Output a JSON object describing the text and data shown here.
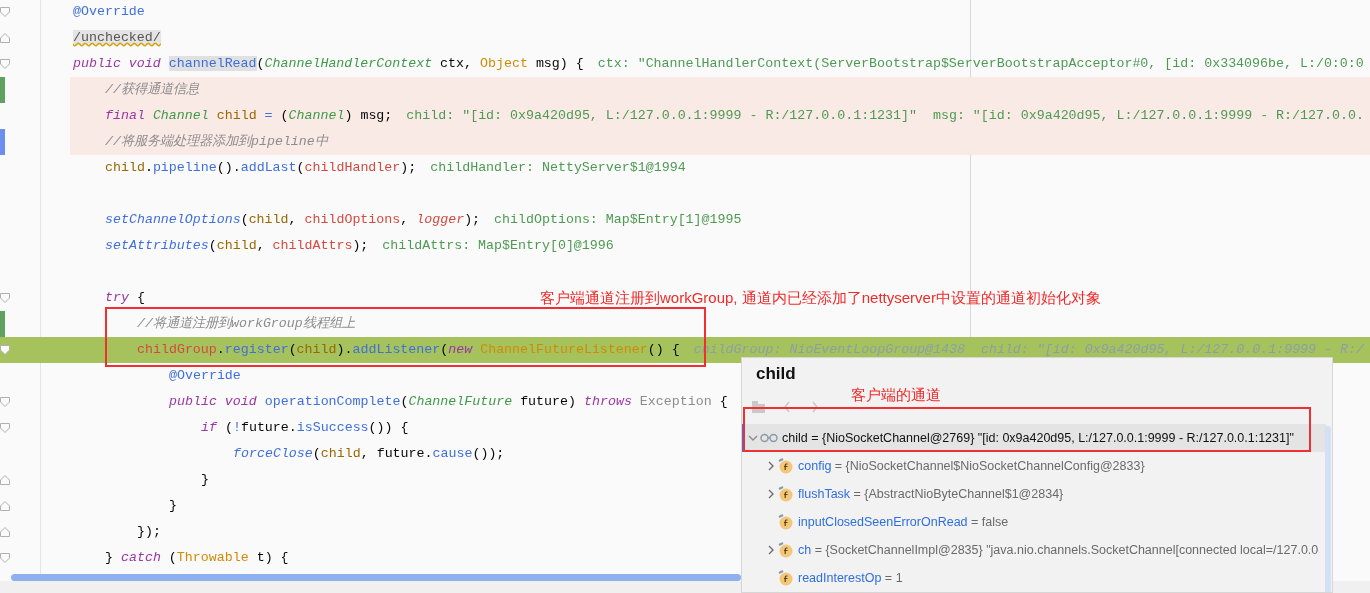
{
  "editor": {
    "lines": [
      {
        "kind": "code",
        "changed": false,
        "current": false,
        "added_mark": false,
        "modified_mark": false,
        "fold_start": true,
        "fold_end": false,
        "tokens": [
          {
            "text": "@Override",
            "kind": "annotation"
          }
        ]
      },
      {
        "kind": "code",
        "changed": false,
        "current": false,
        "added_mark": false,
        "modified_mark": false,
        "fold_start": false,
        "fold_end": true,
        "tokens": [
          {
            "text": "/unchecked/",
            "kind": "suppressed"
          }
        ]
      },
      {
        "kind": "code",
        "changed": false,
        "current": false,
        "added_mark": false,
        "modified_mark": false,
        "fold_start": true,
        "fold_end": false,
        "tokens": [
          {
            "text": "public",
            "kind": "keyword"
          },
          {
            "text": " void ",
            "kind": "keyword"
          },
          {
            "text": "channelRead",
            "kind": "selected"
          },
          {
            "text": "(",
            "kind": "plain"
          },
          {
            "text": "ChannelHandlerContext",
            "kind": "type"
          },
          {
            "text": " ctx, ",
            "kind": "plain"
          },
          {
            "text": "Object",
            "kind": "class"
          },
          {
            "text": " msg) {",
            "kind": "plain"
          }
        ],
        "hint": "ctx: \"ChannelHandlerContext(ServerBootstrap$ServerBootstrapAcceptor#0, [id: 0x334096be, L:/0:0:0",
        "children": [
          {
            "kind": "code",
            "changed": true,
            "current": false,
            "added_mark": true,
            "modified_mark": false,
            "fold_start": false,
            "fold_end": false,
            "tokens": [
              {
                "text": "//获得通道信息",
                "kind": "comment"
              }
            ]
          },
          {
            "kind": "code",
            "changed": true,
            "current": false,
            "added_mark": false,
            "modified_mark": false,
            "fold_start": false,
            "fold_end": false,
            "tokens": [
              {
                "text": "final",
                "kind": "keyword"
              },
              {
                "text": " Channel",
                "kind": "type"
              },
              {
                "text": " child",
                "kind": "local"
              },
              {
                "text": " =",
                "kind": "operator"
              },
              {
                "text": " (",
                "kind": "plain"
              },
              {
                "text": "Channel",
                "kind": "type"
              },
              {
                "text": ") msg;",
                "kind": "plain"
              }
            ],
            "hint": "child: \"[id: 0x9a420d95, L:/127.0.0.1:9999 - R:/127.0.0.1:1231]\"  msg: \"[id: 0x9a420d95, L:/127.0.0.1:9999 - R:/127.0.0."
          },
          {
            "kind": "code",
            "changed": true,
            "current": false,
            "added_mark": false,
            "modified_mark": true,
            "fold_start": false,
            "fold_end": false,
            "tokens": [
              {
                "text": "//将服务端处理器添加到pipeline中",
                "kind": "comment"
              }
            ]
          },
          {
            "kind": "code",
            "changed": false,
            "current": false,
            "added_mark": false,
            "modified_mark": false,
            "fold_start": false,
            "fold_end": false,
            "tokens": [
              {
                "text": "child",
                "kind": "local"
              },
              {
                "text": ".",
                "kind": "plain"
              },
              {
                "text": "pipeline",
                "kind": "method"
              },
              {
                "text": "().",
                "kind": "plain"
              },
              {
                "text": "addLast",
                "kind": "method"
              },
              {
                "text": "(",
                "kind": "plain"
              },
              {
                "text": "childHandler",
                "kind": "field"
              },
              {
                "text": ");",
                "kind": "plain"
              }
            ],
            "hint": "childHandler: NettyServer$1@1994"
          },
          {
            "kind": "blank"
          },
          {
            "kind": "code",
            "changed": false,
            "current": false,
            "added_mark": false,
            "modified_mark": false,
            "fold_start": false,
            "fold_end": false,
            "tokens": [
              {
                "text": "setChannelOptions",
                "kind": "static_method"
              },
              {
                "text": "(",
                "kind": "plain"
              },
              {
                "text": "child",
                "kind": "local"
              },
              {
                "text": ", ",
                "kind": "plain"
              },
              {
                "text": "childOptions",
                "kind": "field"
              },
              {
                "text": ", ",
                "kind": "plain"
              },
              {
                "text": "logger",
                "kind": "field_italic"
              },
              {
                "text": ");",
                "kind": "plain"
              }
            ],
            "hint": "childOptions: Map$Entry[1]@1995"
          },
          {
            "kind": "code",
            "changed": false,
            "current": false,
            "added_mark": false,
            "modified_mark": false,
            "fold_start": false,
            "fold_end": false,
            "tokens": [
              {
                "text": "setAttributes",
                "kind": "static_method"
              },
              {
                "text": "(",
                "kind": "plain"
              },
              {
                "text": "child",
                "kind": "local"
              },
              {
                "text": ", ",
                "kind": "plain"
              },
              {
                "text": "childAttrs",
                "kind": "field"
              },
              {
                "text": ");",
                "kind": "plain"
              }
            ],
            "hint": "childAttrs: Map$Entry[0]@1996"
          },
          {
            "kind": "blank"
          },
          {
            "kind": "code",
            "changed": false,
            "current": false,
            "added_mark": false,
            "modified_mark": false,
            "fold_start": true,
            "fold_end": false,
            "tokens": [
              {
                "text": "try",
                "kind": "keyword"
              },
              {
                "text": " {",
                "kind": "plain"
              }
            ],
            "children": [
              {
                "kind": "code",
                "changed": false,
                "current": false,
                "added_mark": true,
                "modified_mark": false,
                "fold_start": false,
                "fold_end": false,
                "tokens": [
                  {
                    "text": "//将通道注册到workGroup线程组上",
                    "kind": "comment"
                  }
                ]
              },
              {
                "kind": "code",
                "current": true,
                "added_mark": false,
                "modified_mark": false,
                "fold_start": true,
                "fold_end": false,
                "tokens": [
                  {
                    "text": "childGroup",
                    "kind": "field"
                  },
                  {
                    "text": ".",
                    "kind": "plain"
                  },
                  {
                    "text": "register",
                    "kind": "method"
                  },
                  {
                    "text": "(",
                    "kind": "plain"
                  },
                  {
                    "text": "child",
                    "kind": "local"
                  },
                  {
                    "text": ").",
                    "kind": "plain"
                  },
                  {
                    "text": "addListener",
                    "kind": "method"
                  },
                  {
                    "text": "(",
                    "kind": "plain"
                  },
                  {
                    "text": "new",
                    "kind": "keyword"
                  },
                  {
                    "text": " ChannelFutureListener",
                    "kind": "class"
                  },
                  {
                    "text": "() {",
                    "kind": "plain"
                  }
                ],
                "hint": "childGroup: NioEventLoopGroup@1438  child: \"[id: 0x9a420d95, L:/127.0.0.1:9999 - R:/",
                "children": [
                  {
                    "kind": "code",
                    "changed": false,
                    "current": false,
                    "added_mark": false,
                    "modified_mark": false,
                    "fold_start": false,
                    "fold_end": false,
                    "tokens": [
                      {
                        "text": "@Override",
                        "kind": "annotation"
                      }
                    ]
                  },
                  {
                    "kind": "code",
                    "changed": false,
                    "current": false,
                    "added_mark": false,
                    "modified_mark": false,
                    "fold_start": true,
                    "fold_end": false,
                    "tokens": [
                      {
                        "text": "public",
                        "kind": "keyword"
                      },
                      {
                        "text": " void",
                        "kind": "keyword"
                      },
                      {
                        "text": " operationComplete",
                        "kind": "method"
                      },
                      {
                        "text": "(",
                        "kind": "plain"
                      },
                      {
                        "text": "ChannelFuture",
                        "kind": "type"
                      },
                      {
                        "text": " future) ",
                        "kind": "plain"
                      },
                      {
                        "text": "throws",
                        "kind": "keyword"
                      },
                      {
                        "text": " Exception",
                        "kind": "exception"
                      },
                      {
                        "text": " {",
                        "kind": "plain"
                      }
                    ],
                    "children": [
                      {
                        "kind": "code",
                        "changed": false,
                        "current": false,
                        "added_mark": false,
                        "modified_mark": false,
                        "fold_start": true,
                        "fold_end": false,
                        "tokens": [
                          {
                            "text": "if",
                            "kind": "keyword"
                          },
                          {
                            "text": " (",
                            "kind": "plain"
                          },
                          {
                            "text": "!",
                            "kind": "operator"
                          },
                          {
                            "text": "future.",
                            "kind": "plain"
                          },
                          {
                            "text": "isSuccess",
                            "kind": "method"
                          },
                          {
                            "text": "()) {",
                            "kind": "plain"
                          }
                        ],
                        "children": [
                          {
                            "kind": "code",
                            "changed": false,
                            "current": false,
                            "added_mark": false,
                            "modified_mark": false,
                            "fold_start": false,
                            "fold_end": false,
                            "tokens": [
                              {
                                "text": "forceClose",
                                "kind": "static_method"
                              },
                              {
                                "text": "(",
                                "kind": "plain"
                              },
                              {
                                "text": "child",
                                "kind": "local"
                              },
                              {
                                "text": ", future.",
                                "kind": "plain"
                              },
                              {
                                "text": "cause",
                                "kind": "method"
                              },
                              {
                                "text": "());",
                                "kind": "plain"
                              }
                            ]
                          }
                        ]
                      },
                      {
                        "kind": "code",
                        "changed": false,
                        "current": false,
                        "added_mark": false,
                        "modified_mark": false,
                        "fold_start": false,
                        "fold_end": true,
                        "tokens": [
                          {
                            "text": "}",
                            "kind": "plain"
                          }
                        ]
                      }
                    ]
                  },
                  {
                    "kind": "code",
                    "changed": false,
                    "current": false,
                    "added_mark": false,
                    "modified_mark": false,
                    "fold_start": false,
                    "fold_end": true,
                    "tokens": [
                      {
                        "text": "}",
                        "kind": "plain"
                      }
                    ]
                  }
                ]
              },
              {
                "kind": "code",
                "changed": false,
                "current": false,
                "added_mark": false,
                "modified_mark": false,
                "fold_start": false,
                "fold_end": true,
                "tokens": [
                  {
                    "text": "});",
                    "kind": "plain"
                  }
                ]
              }
            ]
          },
          {
            "kind": "code",
            "changed": false,
            "current": false,
            "added_mark": false,
            "modified_mark": false,
            "fold_start": true,
            "fold_end": false,
            "tokens": [
              {
                "text": "} ",
                "kind": "plain"
              },
              {
                "text": "catch",
                "kind": "keyword"
              },
              {
                "text": " (",
                "kind": "plain"
              },
              {
                "text": "Throwable",
                "kind": "class"
              },
              {
                "text": " t) {",
                "kind": "plain"
              }
            ]
          }
        ]
      }
    ]
  },
  "annotations": [
    {
      "text": "客户端通道注册到workGroup, 通道内已经添加了nettyserver中设置的通道初始化对象"
    },
    {
      "text": "客户端的通道"
    }
  ],
  "popup": {
    "title": "child",
    "toolbar": [
      {
        "kind": "pin",
        "disabled": true
      },
      {
        "kind": "back",
        "disabled": true
      },
      {
        "kind": "forward",
        "disabled": true
      }
    ],
    "tree": [
      {
        "name": "child",
        "value": "= {NioSocketChannel@2769} \"[id: 0x9a420d95, L:/127.0.0.1:9999 - R:/127.0.0.1:1231]\"",
        "kind": "watch",
        "expanded": true,
        "selected": true,
        "children": [
          {
            "name": "config",
            "value": "= {NioSocketChannel$NioSocketChannelConfig@2833}",
            "kind": "field",
            "expanded": false,
            "selected": false
          },
          {
            "name": "flushTask",
            "value": "= {AbstractNioByteChannel$1@2834}",
            "kind": "field",
            "expanded": false,
            "selected": false
          },
          {
            "name": "inputClosedSeenErrorOnRead",
            "value": "= false",
            "kind": "field",
            "selected": false
          },
          {
            "name": "ch",
            "value": "= {SocketChannelImpl@2835} \"java.nio.channels.SocketChannel[connected local=/127.0.0",
            "kind": "field",
            "expanded": false,
            "selected": false
          },
          {
            "name": "readInterestOp",
            "value": "= 1",
            "kind": "field",
            "selected": false
          }
        ]
      }
    ]
  }
}
